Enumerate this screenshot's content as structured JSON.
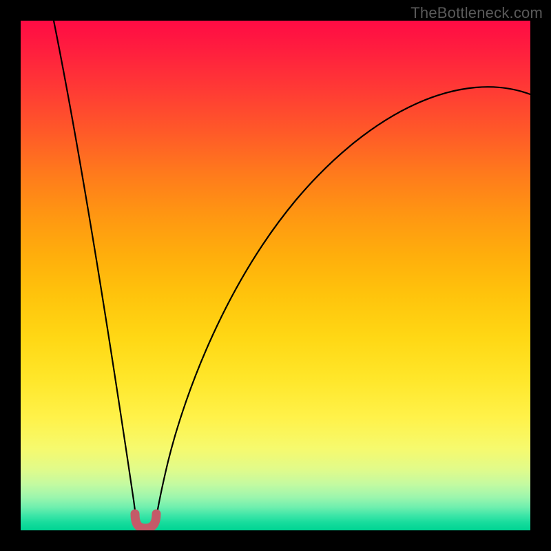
{
  "watermark": "TheBottleneck.com",
  "chart_data": {
    "type": "line",
    "title": "",
    "xlabel": "",
    "ylabel": "",
    "xlim": [
      0,
      100
    ],
    "ylim": [
      0,
      100
    ],
    "grid": false,
    "legend": false,
    "series": [
      {
        "name": "left-branch",
        "x": [
          6.5,
          8,
          10,
          12,
          14,
          16,
          18,
          20,
          21,
          22,
          22.7
        ],
        "values": [
          100,
          90,
          78,
          66,
          54,
          42,
          30,
          18,
          12,
          6,
          2
        ]
      },
      {
        "name": "right-branch",
        "x": [
          26.3,
          27,
          28,
          29,
          31,
          34,
          38,
          44,
          52,
          62,
          74,
          88,
          100
        ],
        "values": [
          2,
          6,
          12,
          18,
          28,
          40,
          52,
          62,
          70,
          76,
          80.5,
          83.5,
          85.5
        ]
      },
      {
        "name": "optimal-marker",
        "x": [
          22.7,
          23.2,
          24.0,
          24.5,
          25.3,
          25.8,
          26.3
        ],
        "values": [
          2.0,
          0.4,
          0.0,
          0.0,
          0.0,
          0.4,
          2.0
        ]
      }
    ],
    "colors": {
      "curve": "#000000",
      "marker": "#c45a68",
      "gradient_top": "#ff0b44",
      "gradient_bottom": "#00d493"
    }
  }
}
